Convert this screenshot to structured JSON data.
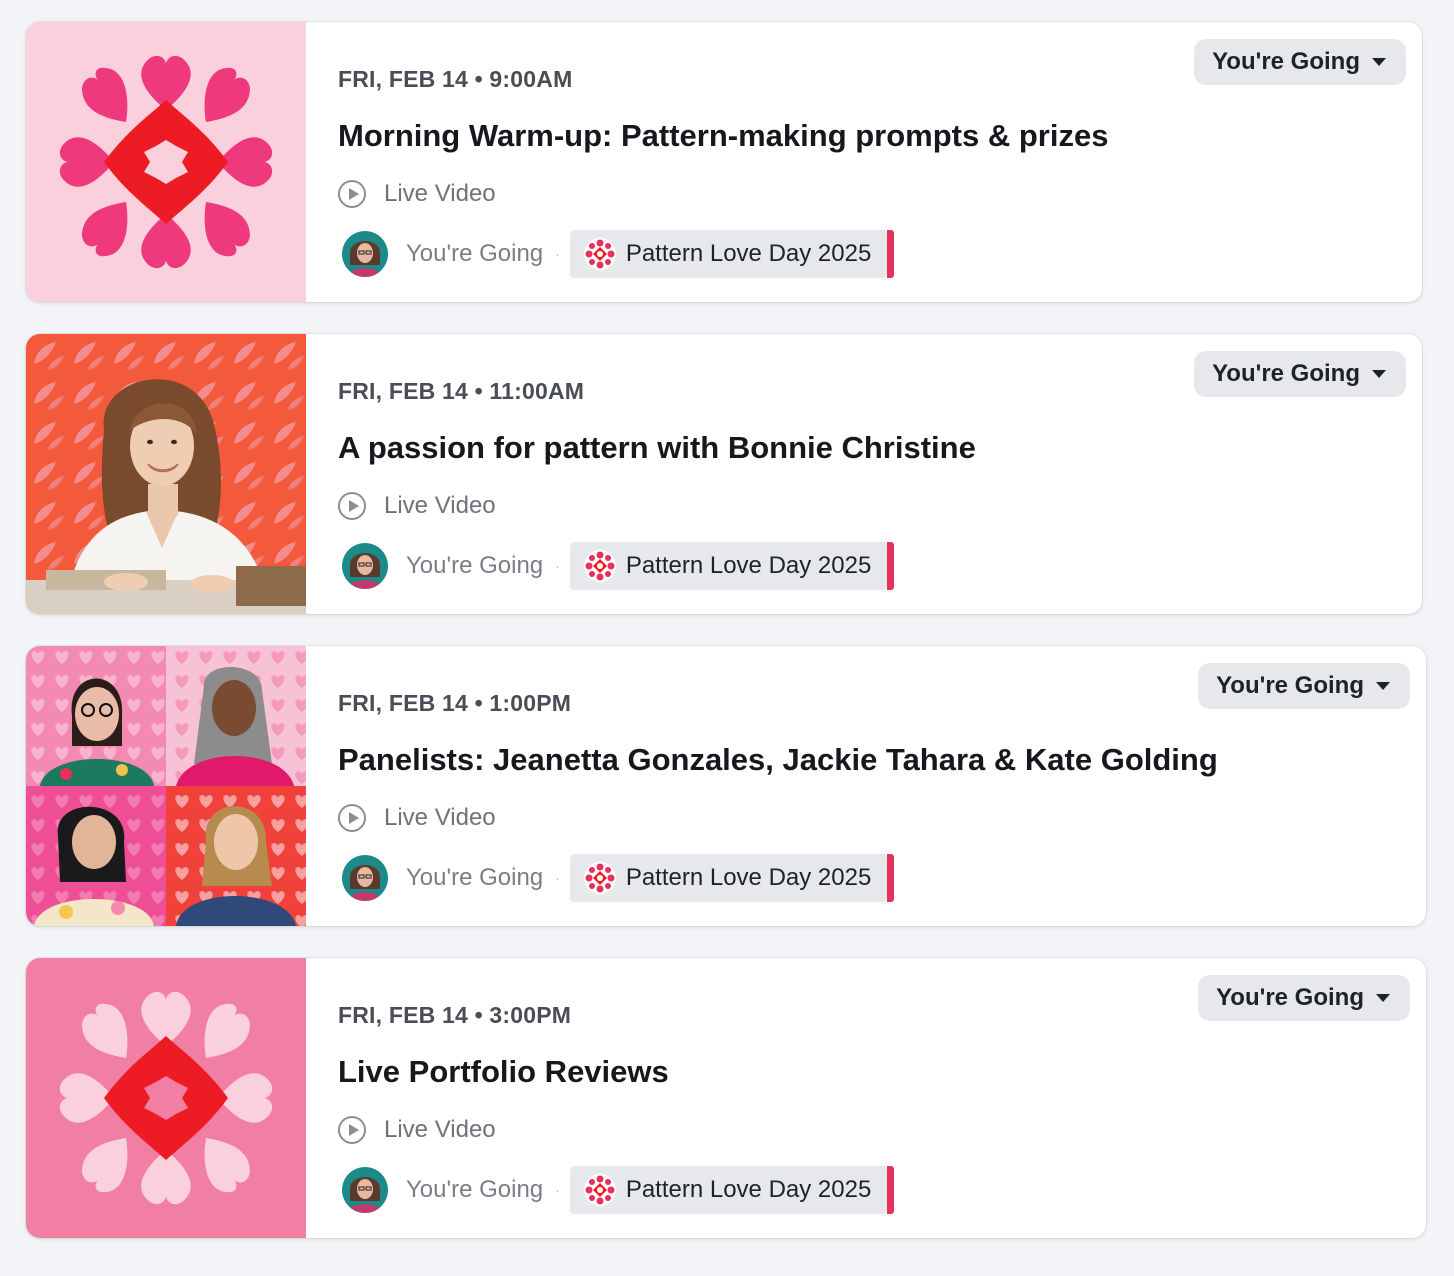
{
  "events": [
    {
      "date": "FRI, FEB 14",
      "time": "9:00AM",
      "datetime": "FRI, FEB 14 • 9:00AM",
      "title": "Morning Warm-up: Pattern-making prompts & prizes",
      "type": "Live Video",
      "rsvp_status": "You're Going",
      "attendance": "You're Going",
      "group": "Pattern Love Day 2025",
      "thumbnail": "heart-flower-graphic-pink"
    },
    {
      "date": "FRI, FEB 14",
      "time": "11:00AM",
      "datetime": "FRI, FEB 14 • 11:00AM",
      "title": "A passion for pattern with Bonnie Christine",
      "type": "Live Video",
      "rsvp_status": "You're Going",
      "attendance": "You're Going",
      "group": "Pattern Love Day 2025",
      "thumbnail": "speaker-portrait"
    },
    {
      "date": "FRI, FEB 14",
      "time": "1:00PM",
      "datetime": "FRI, FEB 14 • 1:00PM",
      "title": "Panelists: Jeanetta Gonzales, Jackie Tahara & Kate Golding",
      "type": "Live Video",
      "rsvp_status": "You're Going",
      "attendance": "You're Going",
      "group": "Pattern Love Day 2025",
      "thumbnail": "panelists-grid"
    },
    {
      "date": "FRI, FEB 14",
      "time": "3:00PM",
      "datetime": "FRI, FEB 14 • 3:00PM",
      "title": "Live Portfolio Reviews",
      "type": "Live Video",
      "rsvp_status": "You're Going",
      "attendance": "You're Going",
      "group": "Pattern Love Day 2025",
      "thumbnail": "heart-flower-graphic-light"
    }
  ],
  "colors": {
    "background": "#f3f4f7",
    "accent": "#e8305a",
    "chip": "#e6e8ec",
    "heart_pink": "#ee3a7d",
    "heart_red": "#ed1c24"
  }
}
